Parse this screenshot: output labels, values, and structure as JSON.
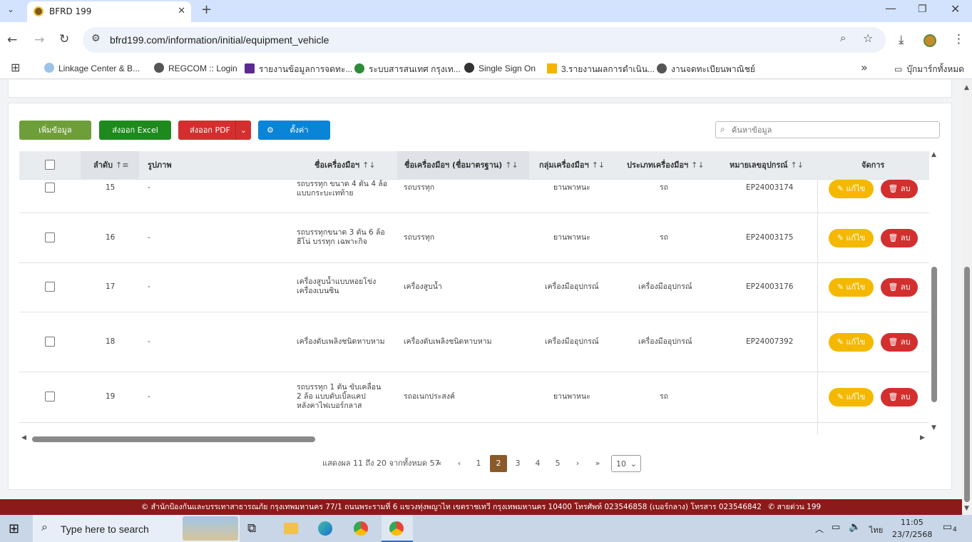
{
  "browser": {
    "tab_title": "BFRD 199",
    "url": "bfrd199.com/information/initial/equipment_vehicle",
    "bookmarks": [
      "Linkage Center & B...",
      "REGCOM :: Login",
      "รายงานข้อมูลการจดทะ...",
      "ระบบสารสนเทศ กรุงเท...",
      "Single Sign On",
      "3.รายงานผลการดำเนิน...",
      "งานจดทะเบียนพาณิชย์"
    ],
    "all_bookmarks": "บุ๊กมาร์กทั้งหมด"
  },
  "toolbar": {
    "add_label": "เพิ่มข้อมูล",
    "excel_label": "ส่งออก Excel",
    "pdf_label": "ส่งออก PDF",
    "settings_label": "ตั้งค่า",
    "search_placeholder": "ค้นหาข้อมูล"
  },
  "colors": {
    "add": "#6e9e3a",
    "excel": "#1e8a1e",
    "pdf": "#d32f2f",
    "settings": "#0a84d6",
    "edit": "#f5b800",
    "delete": "#d32f2f",
    "footer": "#8b1a1a",
    "active_page": "#8b5a2b"
  },
  "table": {
    "headers": {
      "index": "ลำดับ",
      "image": "รูปภาพ",
      "name": "ชื่อเครื่องมือฯ",
      "std_name": "ชื่อเครื่องมือฯ (ชื่อมาตรฐาน)",
      "group": "กลุ่มเครื่องมือฯ",
      "type": "ประเภทเครื่องมือฯ",
      "code": "หมายเลขอุปกรณ์",
      "actions": "จัดการ"
    },
    "edit_label": "แก้ไข",
    "delete_label": "ลบ",
    "rows": [
      {
        "no": "15",
        "image": "-",
        "name": "รถบรรทุก ขนาด 4 ตัน 4 ล้อ แบบกระบะเทท้าย",
        "std": "รถบรรทุก",
        "group": "ยานพาหนะ",
        "type": "รถ",
        "code": "EP24003174"
      },
      {
        "no": "16",
        "image": "-",
        "name": "รถบรรทุกขนาด 3 ตัน 6 ล้อ ฮีโน่ บรรทุก เฉพาะกิจ",
        "std": "รถบรรทุก",
        "group": "ยานพาหนะ",
        "type": "รถ",
        "code": "EP24003175"
      },
      {
        "no": "17",
        "image": "-",
        "name": "เครื่องสูบน้ำแบบหอยโข่ง เครื่องเบนซิน",
        "std": "เครื่องสูบน้ำ",
        "group": "เครื่องมืออุปกรณ์",
        "type": "เครื่องมืออุปกรณ์",
        "code": "EP24003176"
      },
      {
        "no": "18",
        "image": "-",
        "name": "เครื่องดับเพลิงชนิดหาบหาม",
        "std": "เครื่องดับเพลิงชนิดหาบหาม",
        "group": "เครื่องมืออุปกรณ์",
        "type": "เครื่องมืออุปกรณ์",
        "code": "EP24007392"
      },
      {
        "no": "19",
        "image": "-",
        "name": "รถบรรทุก 1 ตัน ขับเคลื่อน 2 ล้อ แบบดับเบิ้ลแคป หลังคาไฟเบอร์กลาส",
        "std": "รถอเนกประสงค์",
        "group": "ยานพาหนะ",
        "type": "รถ",
        "code": ""
      }
    ]
  },
  "pagination": {
    "summary": "แสดงผล 11 ถึง 20 จากทั้งหมด 57",
    "first": "«",
    "prev": "‹",
    "next": "›",
    "last": "»",
    "pages": [
      "1",
      "2",
      "3",
      "4",
      "5"
    ],
    "current_page": "2",
    "page_size": "10"
  },
  "footer": {
    "text": "© สำนักป้องกันและบรรเทาสาธารณภัย กรุงเทพมหานคร 77/1 ถนนพระรามที่ 6 แขวงทุ่งพญาไท เขตราชเทวี กรุงเทพมหานคร 10400 โทรศัพท์ 023546858 (เบอร์กลาง) โทรสาร 023546842",
    "hotline": "สายด่วน 199"
  },
  "taskbar": {
    "search_placeholder": "Type here to search",
    "time": "11:05",
    "date": "23/7/2568",
    "lang": "ไทย",
    "notification_count": "4"
  }
}
